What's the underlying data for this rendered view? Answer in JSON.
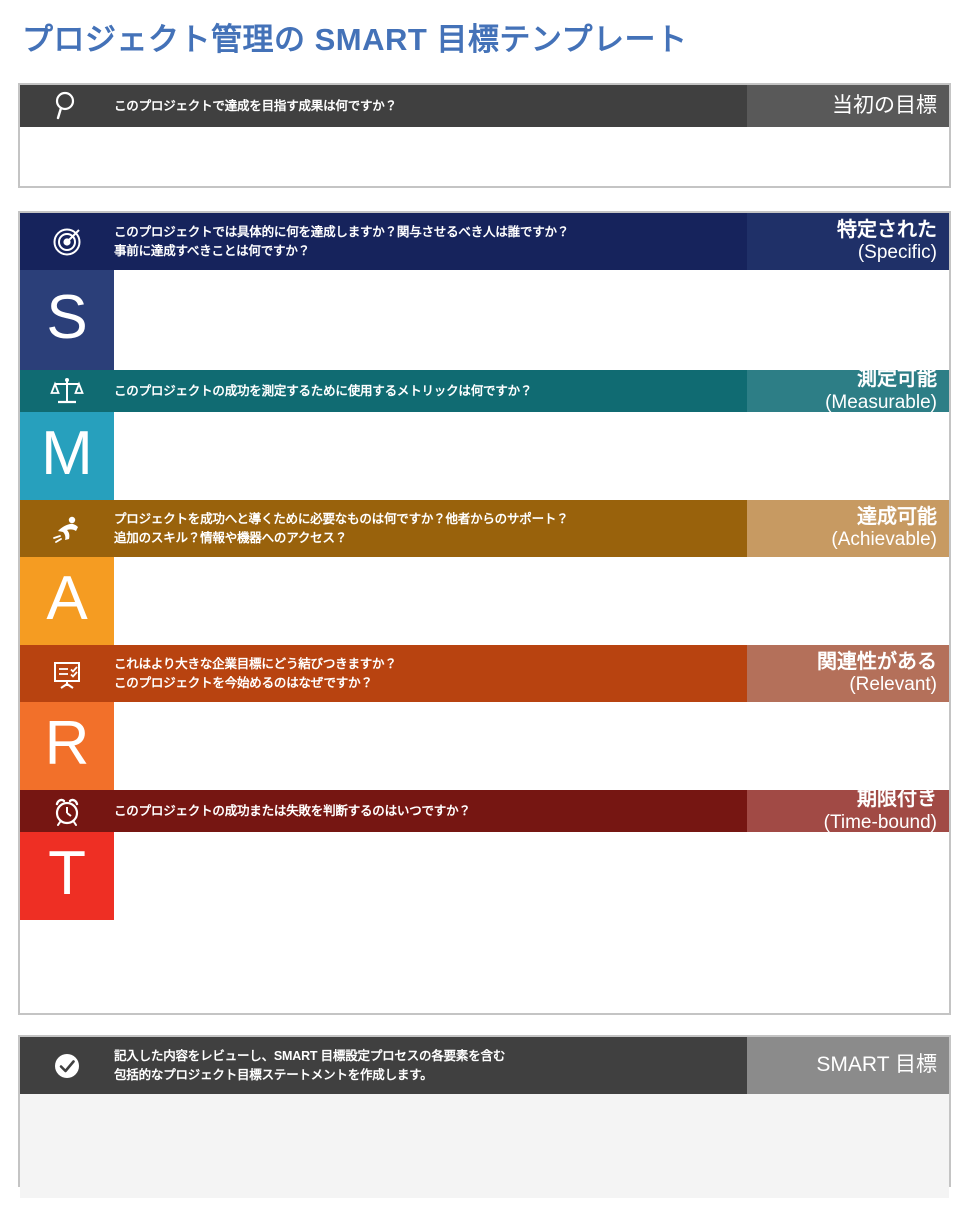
{
  "page": {
    "title": "プロジェクト管理の SMART 目標テンプレート"
  },
  "colors": {
    "title": "#4472b8",
    "initial_header": "#404040",
    "initial_label": "#595959",
    "specific_header": "#16235c",
    "specific_label": "#1f3068",
    "specific_tile": "#2b3f79",
    "measurable_header": "#106b72",
    "measurable_label": "#2d7e86",
    "measurable_tile": "#27a0bd",
    "achievable_header": "#99620c",
    "achievable_label": "#c79a62",
    "achievable_tile": "#f59c22",
    "relevant_header": "#b84310",
    "relevant_label": "#b4705a",
    "relevant_tile": "#f2702a",
    "timebound_header": "#761612",
    "timebound_label": "#a14a45",
    "timebound_tile": "#ee2f24",
    "final_header": "#404040",
    "final_label": "#8b8b8b",
    "page_border": "#c4c4c4"
  },
  "initial": {
    "icon": "magnifier-icon",
    "question_line1": "このプロジェクトで達成を目指す成果は何ですか？",
    "label": "当初の目標",
    "answer_value": ""
  },
  "smart": {
    "sections": [
      {
        "letter": "S",
        "icon": "target-icon",
        "question_line1": "このプロジェクトでは具体的に何を達成しますか？関与させるべき人は誰ですか？",
        "question_line2": "事前に達成すべきことは何ですか？",
        "label_jp": "特定された",
        "label_en": "(Specific)",
        "answer_value": ""
      },
      {
        "letter": "M",
        "icon": "scales-icon",
        "question_line1": "このプロジェクトの成功を測定するために使用するメトリックは何ですか？",
        "question_line2": "",
        "label_jp": "測定可能",
        "label_en": "(Measurable)",
        "answer_value": ""
      },
      {
        "letter": "A",
        "icon": "runner-icon",
        "question_line1": "プロジェクトを成功へと導くために必要なものは何ですか？他者からのサポート？",
        "question_line2": "追加のスキル？情報や機器へのアクセス？",
        "label_jp": "達成可能",
        "label_en": "(Achievable)",
        "answer_value": ""
      },
      {
        "letter": "R",
        "icon": "presentation-board-icon",
        "question_line1": "これはより大きな企業目標にどう結びつきますか？",
        "question_line2": "このプロジェクトを今始めるのはなぜですか？",
        "label_jp": "関連性がある",
        "label_en": "(Relevant)",
        "answer_value": ""
      },
      {
        "letter": "T",
        "icon": "alarm-clock-icon",
        "question_line1": "このプロジェクトの成功または失敗を判断するのはいつですか？",
        "question_line2": "",
        "label_jp": "期限付き",
        "label_en": "(Time-bound)",
        "answer_value": ""
      }
    ]
  },
  "final": {
    "icon": "check-circle-icon",
    "question_line1": "記入した内容をレビューし、SMART 目標設定プロセスの各要素を含む",
    "question_line2": "包括的なプロジェクト目標ステートメントを作成します。",
    "label": "SMART 目標",
    "answer_value": ""
  }
}
